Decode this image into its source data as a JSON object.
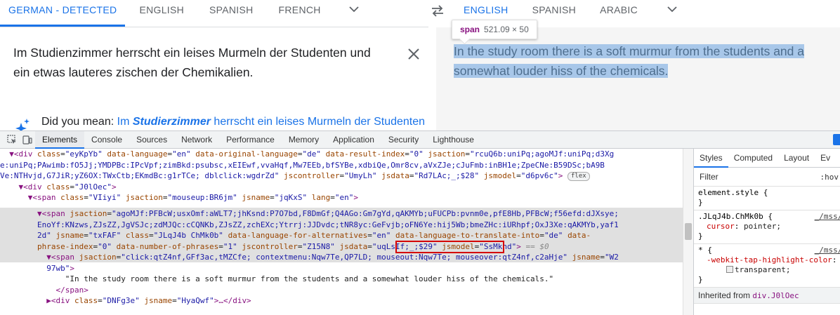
{
  "source": {
    "tabs": [
      "GERMAN - DETECTED",
      "ENGLISH",
      "SPANISH",
      "FRENCH"
    ],
    "text": "Im Studienzimmer herrscht ein leises Murmeln der Studenten und ein etwas lauteres zischen der Chemikalien.",
    "did_you_mean_label": "Did you mean:",
    "suggestion_pre": "Im ",
    "suggestion_bold": "Studierzimmer",
    "suggestion_post": " herrscht ein leises Murmeln der Studenten"
  },
  "target": {
    "tabs": [
      "ENGLISH",
      "SPANISH",
      "ARABIC"
    ],
    "text": "In the study room there is a soft murmur from the students and a somewhat louder hiss of the chemicals."
  },
  "tooltip": {
    "tag": "span",
    "dims": "521.09 × 50"
  },
  "devtools": {
    "tabs": [
      "Elements",
      "Console",
      "Sources",
      "Network",
      "Performance",
      "Memory",
      "Application",
      "Security",
      "Lighthouse"
    ],
    "elements": {
      "l1_tag_open": "▼<div ",
      "l1_a1": "class",
      "l1_v1": "\"eyKpYb\"",
      "l1_a2": "data-language",
      "l1_v2": "\"en\"",
      "l1_a3": "data-original-language",
      "l1_v3": "\"de\"",
      "l1_a4": "data-result-index",
      "l1_v4": "\"0\"",
      "l1_a5": "jsaction",
      "l1_v5": "\"rcuQ6b:uniPq;agoMJf:uniPq;d3Xge:uniPq;PAwimb:fO5Jj;YMDPBc:IPcVpf;zimBkd:psubsc,xEIEwf,vvaHqf,Mw7EEb,bfSYBe,xdbiQe,Omr8cv,aVxZJe;cJuFmb:inBH1e;ZpeCNe:B59DSc;bA9BVe:NTHvjd,G7JiR;yZ6OX:TWxCtb;EKmdBc:g1rTCe; dblclick:wgdrZd\"",
      "l1_a6": "jscontroller",
      "l1_v6": "\"UmyLh\"",
      "l1_a7": "jsdata",
      "l1_v7": "\"Rd7LAc;_;$28\"",
      "l1_a8": "jsmodel",
      "l1_v8": "\"d6pv6c\"",
      "flex_badge": "flex",
      "l2_a1": "class",
      "l2_v1": "\"J0lOec\"",
      "l3_a1": "class",
      "l3_v1": "\"VIiyi\"",
      "l3_a2": "jsaction",
      "l3_v2": "\"mouseup:BR6jm\"",
      "l3_a3": "jsname",
      "l3_v3": "\"jqKxS\"",
      "l3_a4": "lang",
      "l3_v4": "\"en\"",
      "l4_a1": "jsaction",
      "l4_v1": "\"agoMJf:PFBcW;usxOmf:aWLT7;jhKsnd:P7O7bd,F8DmGf;Q4AGo:Gm7gYd,qAKMYb;uFUCPb:pvnm0e,pfE8Hb,PFBcW;f56efd:dJXsye;EnoYf:KNzws,ZJsZZ,JgVSJc;zdMJQc:cCQNKb,ZJsZZ,zchEXc;Ytrrj:JJDvdc;tNR8yc:GeFvjb;oFN6Ye:hij5Wb;bmeZHc:iURhpf;OxJ3Xe:qAKMYb,yaf12d\"",
      "l4_a2": "jsname",
      "l4_v2": "\"txFAF\"",
      "l4_a3": "class",
      "l4_v3": "\"JLqJ4b ChMk0b\"",
      "l4_a4": "data-language-for-alternatives",
      "l4_v4": "\"en\"",
      "l4_a5": "data-language-to-translate-into",
      "l4_v5": "\"de\"",
      "l4_a6": "data-phrase-index",
      "l4_v6": "\"0\"",
      "l4_a7": "data-number-of-phrases",
      "l4_v7": "\"1\"",
      "l4_a8": "jscontroller",
      "l4_v8": "\"Z15N8\"",
      "l4_a9": "jsdata",
      "l4_v9": "\"uqLsIf;_;$29\"",
      "l4_a10": "jsmodel",
      "l4_v10": "\"SsMkhd\"",
      "l4_suffix": "== $0",
      "l5_a1": "jsaction",
      "l5_v1": "\"click:qtZ4nf,GFf3ac,tMZCfe; contextmenu:Nqw7Te,QP7LD; mouseout:Nqw7Te; mouseover:qtZ4nf,c2aHje\"",
      "l5_a2": "jsname",
      "l5_v2": "\"W297wb\"",
      "text_node": "\"In the study room there is a soft murmur from the students and a somewhat louder hiss of the chemicals.\"",
      "close_span": "</span>",
      "l8_a1": "class",
      "l8_v1": "\"DNFg3e\"",
      "l8_a2": "jsname",
      "l8_v2": "\"HyaQwf\"",
      "l8_tail": ">…</div>"
    },
    "styles": {
      "tabs": [
        "Styles",
        "Computed",
        "Layout",
        "Ev"
      ],
      "filter_placeholder": "Filter",
      "hov": ":hov",
      "element_style": "element.style {",
      "close_brace": "}",
      "rule1_selector": ".JLqJ4b.ChMk0b {",
      "rule1_source": "_/mss/b",
      "rule1_prop": "cursor",
      "rule1_val": "pointer;",
      "rule2_selector": "* {",
      "rule2_source": "_/mss/b",
      "rule2_prop": "-webkit-tap-highlight-color",
      "rule2_val": "transparent;",
      "inherited_label": "Inherited from",
      "inherited_el": "div.J0lOec"
    }
  }
}
